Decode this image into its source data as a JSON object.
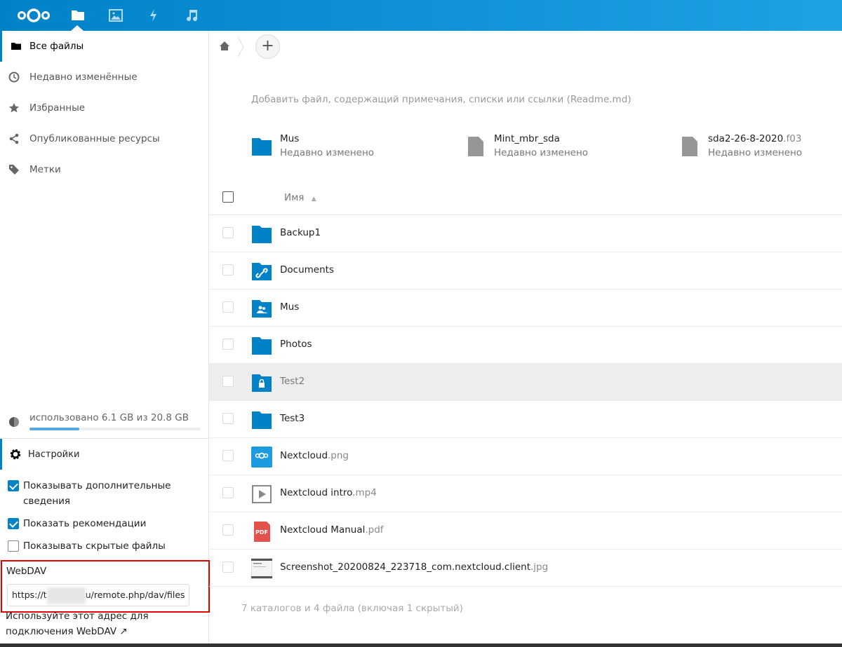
{
  "colors": {
    "brand": "#0082c9",
    "folder": "#0082c9",
    "highlight": "#ededed",
    "webdav_outline": "#e30000"
  },
  "header": {
    "apps": [
      {
        "icon": "folder-icon",
        "name": "files"
      },
      {
        "icon": "image-icon",
        "name": "photos"
      },
      {
        "icon": "lightning-icon",
        "name": "activity"
      },
      {
        "icon": "music-icon",
        "name": "music"
      }
    ]
  },
  "sidebar": {
    "items": [
      {
        "label": "Все файлы",
        "icon": "folder-icon"
      },
      {
        "label": "Недавно изменённые",
        "icon": "clock-icon"
      },
      {
        "label": "Избранные",
        "icon": "star-icon"
      },
      {
        "label": "Опубликованные ресурсы",
        "icon": "share-icon"
      },
      {
        "label": "Метки",
        "icon": "tag-icon"
      }
    ],
    "quota": {
      "text": "использовано 6.1 GB из 20.8 GB",
      "percent": 29
    },
    "settings_label": "Настройки",
    "options": [
      {
        "label": "Показывать дополнительные сведения",
        "checked": true
      },
      {
        "label": "Показать рекомендации",
        "checked": true
      },
      {
        "label": "Показывать скрытые файлы",
        "checked": false
      }
    ],
    "webdav": {
      "label": "WebDAV",
      "url_prefix": "https://t",
      "url_suffix": "u/remote.php/dav/files",
      "hint": "Используйте этот адрес для подключения WebDAV ↗"
    }
  },
  "main": {
    "add_label": "+",
    "readme": "Добавить файл, содержащий примечания, списки или ссылки (Readme.md)",
    "recommendations": [
      {
        "name": "Mus",
        "ext": "",
        "sub": "Недавно изменено",
        "type": "folder"
      },
      {
        "name": "Mint_mbr_sda",
        "ext": "",
        "sub": "Недавно изменено",
        "type": "file"
      },
      {
        "name": "sda2-26-8-2020",
        "ext": ".f03",
        "sub": "Недавно изменено",
        "type": "file"
      }
    ],
    "column_name": "Имя",
    "files": [
      {
        "name": "Backup1",
        "ext": "",
        "type": "folder"
      },
      {
        "name": "Documents",
        "ext": "",
        "type": "folder-link"
      },
      {
        "name": "Mus",
        "ext": "",
        "type": "folder-shared"
      },
      {
        "name": "Photos",
        "ext": "",
        "type": "folder"
      },
      {
        "name": "Test2",
        "ext": "",
        "type": "folder-locked"
      },
      {
        "name": "Test3",
        "ext": "",
        "type": "folder"
      },
      {
        "name": "Nextcloud",
        "ext": ".png",
        "type": "image"
      },
      {
        "name": "Nextcloud intro",
        "ext": ".mp4",
        "type": "video"
      },
      {
        "name": "Nextcloud Manual",
        "ext": ".pdf",
        "type": "pdf"
      },
      {
        "name": "Screenshot_20200824_223718_com.nextcloud.client",
        "ext": ".jpg",
        "type": "screenshot"
      }
    ],
    "summary": "7 каталогов и 4 файла (включая 1 скрытый)"
  }
}
